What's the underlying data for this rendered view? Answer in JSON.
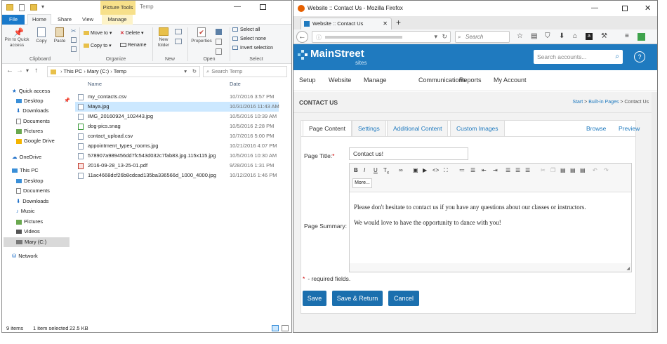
{
  "explorer": {
    "title_label": "Temp",
    "picture_tools": "Picture Tools",
    "tabs": [
      "File",
      "Home",
      "Share",
      "View",
      "Manage"
    ],
    "ribbon": {
      "clipboard": {
        "pin": "Pin to Quick access",
        "copy": "Copy",
        "paste": "Paste",
        "label": "Clipboard"
      },
      "organize": {
        "move_to": "Move to",
        "copy_to": "Copy to",
        "delete": "Delete",
        "rename": "Rename",
        "label": "Organize"
      },
      "new": {
        "new_folder": "New folder",
        "label": "New"
      },
      "open": {
        "properties": "Properties",
        "label": "Open"
      },
      "select": {
        "select_all": "Select all",
        "select_none": "Select none",
        "invert": "Invert selection",
        "label": "Select"
      }
    },
    "breadcrumb": [
      "This PC",
      "Mary (C:)",
      "Temp"
    ],
    "search_placeholder": "Search Temp",
    "nav": [
      "Quick access",
      "Desktop",
      "Downloads",
      "Documents",
      "Pictures",
      "Google Drive",
      "OneDrive",
      "This PC",
      "Desktop",
      "Documents",
      "Downloads",
      "Music",
      "Pictures",
      "Videos",
      "Mary (C:)",
      "Network"
    ],
    "columns": {
      "name": "Name",
      "date": "Date"
    },
    "files": [
      {
        "name": "my_contacts.csv",
        "date": "10/7/2016 3:57 PM"
      },
      {
        "name": "Maya.jpg",
        "date": "10/31/2016 11:43 AM"
      },
      {
        "name": "IMG_20160924_102443.jpg",
        "date": "10/5/2016 10:39 AM"
      },
      {
        "name": "dog-pics.snag",
        "date": "10/5/2016 2:28 PM"
      },
      {
        "name": "contact_upload.csv",
        "date": "10/7/2016 5:00 PM"
      },
      {
        "name": "appointment_types_rooms.jpg",
        "date": "10/21/2016 4:07 PM"
      },
      {
        "name": "578907a989456dd7fc543d032c7fab83.jpg.115x115.jpg",
        "date": "10/5/2016 10:30 AM"
      },
      {
        "name": "2016-09-28_13-25-01.pdf",
        "date": "9/28/2016 1:31 PM"
      },
      {
        "name": "11ac4668dcf26b8cdcad135ba336566d_1000_4000.jpg",
        "date": "10/12/2016 1:46 PM"
      }
    ],
    "status": {
      "items": "9 items",
      "selected": "1 item selected",
      "size": "22.5 KB"
    }
  },
  "firefox": {
    "window_title": "Website :: Contact Us - Mozilla Firefox",
    "tab_title": "Website :: Contact Us",
    "search_placeholder": "Search",
    "site": {
      "logo_main": "MainStreet",
      "logo_sub": "sites",
      "search_placeholder": "Search accounts...",
      "help": "?",
      "menu": [
        "Setup",
        "Website",
        "Manage",
        "Communications",
        "Reports",
        "My Account"
      ],
      "page_title": "CONTACT US",
      "crumbs": {
        "start": "Start",
        "sep1": " > ",
        "built_in": "Built-in Pages",
        "sep2": " > ",
        "current": "Contact Us"
      },
      "tabs": [
        "Page Content",
        "Settings",
        "Additional Content",
        "Custom Images"
      ],
      "browse": "Browse",
      "preview": "Preview",
      "page_title_label": "Page Title:",
      "required_mark": "*",
      "page_title_value": "Contact us!",
      "more_label": "More...",
      "summary_label": "Page Summary:",
      "summary_p1": "Please don't hesitate to contact us if you have any questions about our classes or instructors.",
      "summary_p2": "We would love to have the opportunity to dance with you!",
      "required_note": "- required fields.",
      "buttons": {
        "save": "Save",
        "save_return": "Save & Return",
        "cancel": "Cancel"
      }
    }
  }
}
